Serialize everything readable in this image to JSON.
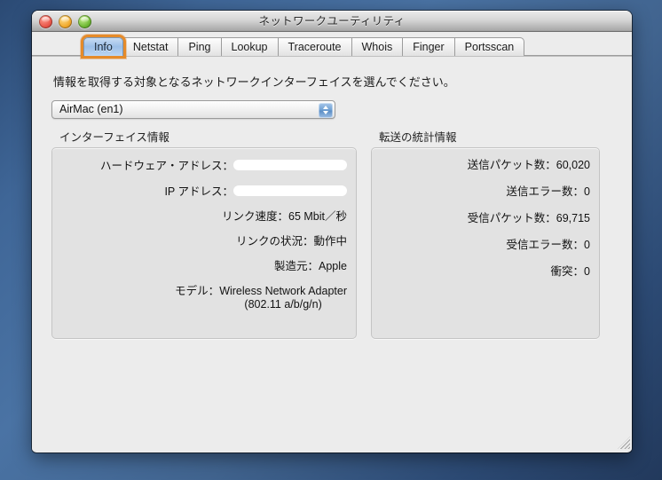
{
  "window": {
    "title": "ネットワークユーティリティ",
    "traffic_lights": {
      "close": "close-button",
      "minimize": "minimize-button",
      "zoom": "zoom-button"
    },
    "colors": {
      "desktop": "#3f6697",
      "titlebar": "#d6d6d6",
      "content_bg": "#ececec",
      "focus_ring": "#e58b2a",
      "selected_tab": "#9cbfe8",
      "group_box_bg": "#e2e2e2"
    }
  },
  "tabs": [
    {
      "label": "Info",
      "selected": true
    },
    {
      "label": "Netstat",
      "selected": false
    },
    {
      "label": "Ping",
      "selected": false
    },
    {
      "label": "Lookup",
      "selected": false
    },
    {
      "label": "Traceroute",
      "selected": false
    },
    {
      "label": "Whois",
      "selected": false
    },
    {
      "label": "Finger",
      "selected": false
    },
    {
      "label": "Portsscan",
      "selected": false
    }
  ],
  "main": {
    "instruction": "情報を取得する対象となるネットワークインターフェイスを選んでください。",
    "interface_popup": {
      "value": "AirMac (en1)",
      "stepper_icon": "up-down-arrows-icon"
    },
    "interface_info": {
      "title": "インターフェイス情報",
      "rows": [
        {
          "label": "ハードウェア・アドレス：",
          "value": "",
          "redacted": true
        },
        {
          "label": "IP アドレス：",
          "value": "",
          "redacted": true
        },
        {
          "label": "リンク速度：",
          "value": "65 Mbit／秒",
          "redacted": false
        },
        {
          "label": "リンクの状況：",
          "value": "動作中",
          "redacted": false
        },
        {
          "label": "製造元：",
          "value": "Apple",
          "redacted": false
        },
        {
          "label": "モデル：",
          "value": "Wireless Network Adapter",
          "value_line2": "(802.11 a/b/g/n)",
          "redacted": false
        }
      ]
    },
    "transfer_stats": {
      "title": "転送の統計情報",
      "rows": [
        {
          "label": "送信パケット数：",
          "value": "60,020"
        },
        {
          "label": "送信エラー数：",
          "value": "0"
        },
        {
          "label": "受信パケット数：",
          "value": "69,715"
        },
        {
          "label": "受信エラー数：",
          "value": "0"
        },
        {
          "label": "衝突：",
          "value": "0"
        }
      ]
    }
  },
  "resize_handle": "resize-handle-icon"
}
